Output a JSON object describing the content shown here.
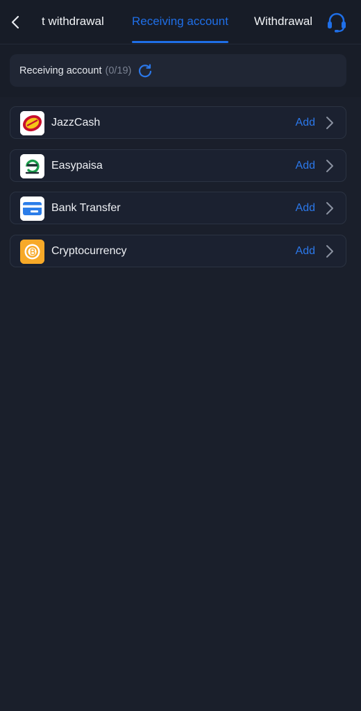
{
  "header": {
    "tabs": [
      {
        "label": "t withdrawal"
      },
      {
        "label": "Receiving account"
      },
      {
        "label": "Withdrawal"
      }
    ],
    "accent_color": "#1f6fe8"
  },
  "summary": {
    "label": "Receiving account",
    "count": "(0/19)"
  },
  "methods": [
    {
      "name": "JazzCash",
      "action": "Add",
      "icon": "jazzcash-logo"
    },
    {
      "name": "Easypaisa",
      "action": "Add",
      "icon": "easypaisa-logo"
    },
    {
      "name": "Bank Transfer",
      "action": "Add",
      "icon": "bank-card-icon"
    },
    {
      "name": "Cryptocurrency",
      "action": "Add",
      "icon": "bitcoin-icon"
    }
  ]
}
